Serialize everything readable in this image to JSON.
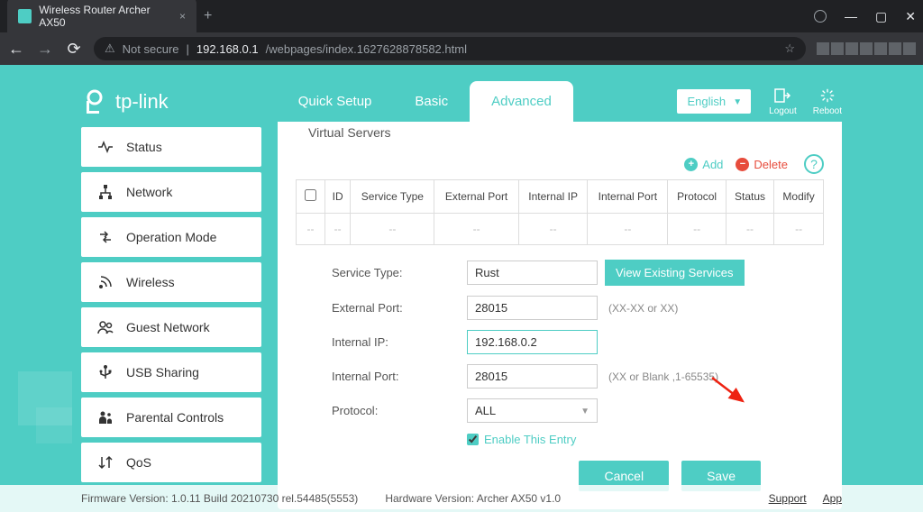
{
  "browser": {
    "tab_title": "Wireless Router Archer AX50",
    "security_label": "Not secure",
    "url_host": "192.168.0.1",
    "url_path": "/webpages/index.1627628878582.html"
  },
  "logo_text": "tp-link",
  "top_tabs": {
    "quick": "Quick Setup",
    "basic": "Basic",
    "advanced": "Advanced"
  },
  "language": "English",
  "top_icons": {
    "logout": "Logout",
    "reboot": "Reboot"
  },
  "sidebar": {
    "status": "Status",
    "network": "Network",
    "operation_mode": "Operation Mode",
    "wireless": "Wireless",
    "guest_network": "Guest Network",
    "usb_sharing": "USB Sharing",
    "parental_controls": "Parental Controls",
    "qos": "QoS"
  },
  "page_title": "Virtual Servers",
  "actions": {
    "add": "Add",
    "delete": "Delete"
  },
  "table": {
    "headers": {
      "id": "ID",
      "service_type": "Service Type",
      "external_port": "External Port",
      "internal_ip": "Internal IP",
      "internal_port": "Internal Port",
      "protocol": "Protocol",
      "status": "Status",
      "modify": "Modify"
    },
    "empty": "--"
  },
  "form": {
    "service_type_label": "Service Type:",
    "service_type_value": "Rust",
    "view_existing": "View Existing Services",
    "external_port_label": "External Port:",
    "external_port_value": "28015",
    "external_port_hint": "(XX-XX or XX)",
    "internal_ip_label": "Internal IP:",
    "internal_ip_value": "192.168.0.2",
    "internal_port_label": "Internal Port:",
    "internal_port_value": "28015",
    "internal_port_hint": "(XX or Blank ,1-65535)",
    "protocol_label": "Protocol:",
    "protocol_value": "ALL",
    "enable_label": "Enable This Entry",
    "cancel": "Cancel",
    "save": "Save"
  },
  "footer": {
    "firmware": "Firmware Version: 1.0.11 Build 20210730 rel.54485(5553)",
    "hardware": "Hardware Version: Archer AX50 v1.0",
    "support": "Support",
    "app": "App"
  }
}
